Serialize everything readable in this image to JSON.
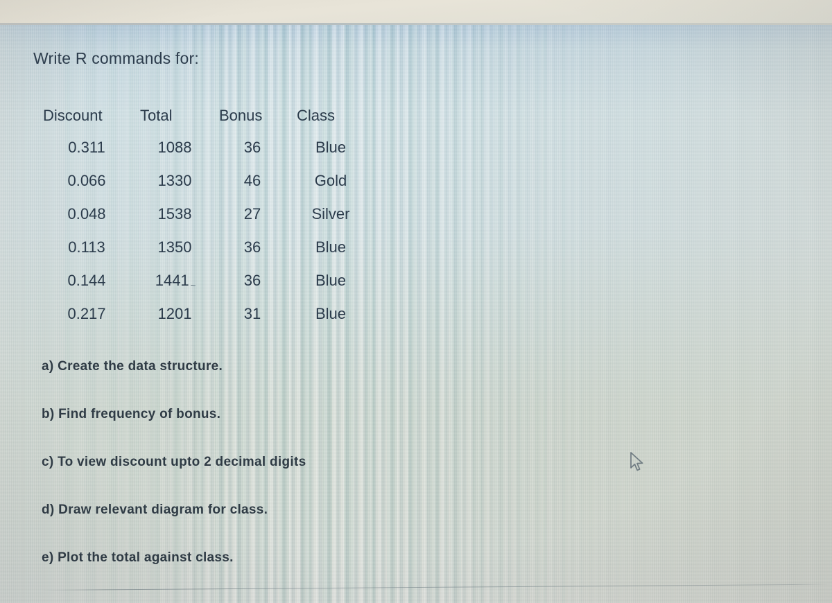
{
  "document": {
    "title": "Write R commands for:"
  },
  "table": {
    "headers": [
      "Discount",
      "Total",
      "Bonus",
      "Class"
    ],
    "rows": [
      {
        "discount": "0.311",
        "total": "1088",
        "bonus": "36",
        "class": "Blue"
      },
      {
        "discount": "0.066",
        "total": "1330",
        "bonus": "46",
        "class": "Gold"
      },
      {
        "discount": "0.048",
        "total": "1538",
        "bonus": "27",
        "class": "Silver"
      },
      {
        "discount": "0.113",
        "total": "1350",
        "bonus": "36",
        "class": "Blue"
      },
      {
        "discount": "0.144",
        "total": "1441",
        "bonus": "36",
        "class": "Blue"
      },
      {
        "discount": "0.217",
        "total": "1201",
        "bonus": "31",
        "class": "Blue"
      }
    ],
    "artifact_mark": "~"
  },
  "questions": [
    "a) Create the data structure.",
    "b) Find frequency of bonus.",
    "c) To view discount upto 2 decimal digits",
    "d) Draw relevant diagram for class.",
    "e) Plot the total against class."
  ],
  "colors": {
    "text_primary": "#2b3b4b",
    "text_questions": "#2f3b45",
    "screen_top": "#a8c2d8",
    "screen_bottom": "#ccd2c8",
    "bezel": "#e4e0d4"
  },
  "cursor": {
    "icon": "mouse-pointer-icon"
  }
}
